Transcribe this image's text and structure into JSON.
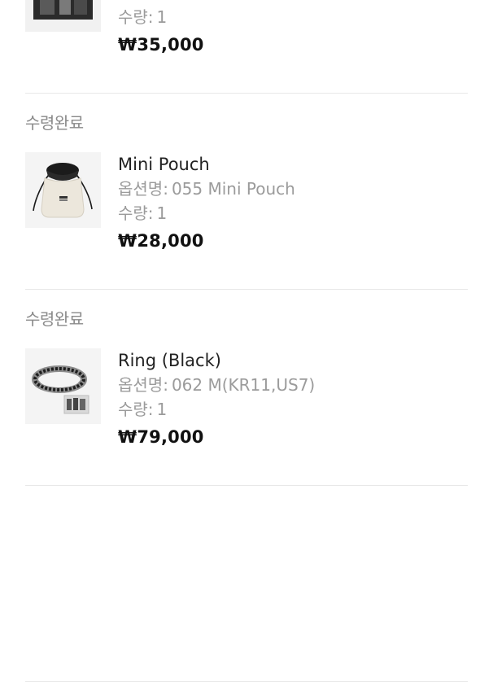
{
  "orders": [
    {
      "status": "",
      "name": "",
      "option_label": "",
      "option_value": "",
      "qty_label": "수량:",
      "qty_value": "1",
      "price": "₩35,000",
      "thumb_icon": "photo-thumbnail"
    },
    {
      "status": "수령완료",
      "name": "Mini Pouch",
      "option_label": "옵션명:",
      "option_value": "055 Mini Pouch",
      "qty_label": "수량:",
      "qty_value": "1",
      "price": "₩28,000",
      "thumb_icon": "pouch-thumbnail"
    },
    {
      "status": "수령완료",
      "name": "Ring (Black)",
      "option_label": "옵션명:",
      "option_value": "062 M(KR11,US7)",
      "qty_label": "수량:",
      "qty_value": "1",
      "price": "₩79,000",
      "thumb_icon": "ring-thumbnail"
    },
    {
      "status": "",
      "name": "",
      "option_label": "",
      "option_value": "",
      "qty_label": "",
      "qty_value": "",
      "price": "",
      "thumb_icon": ""
    }
  ]
}
